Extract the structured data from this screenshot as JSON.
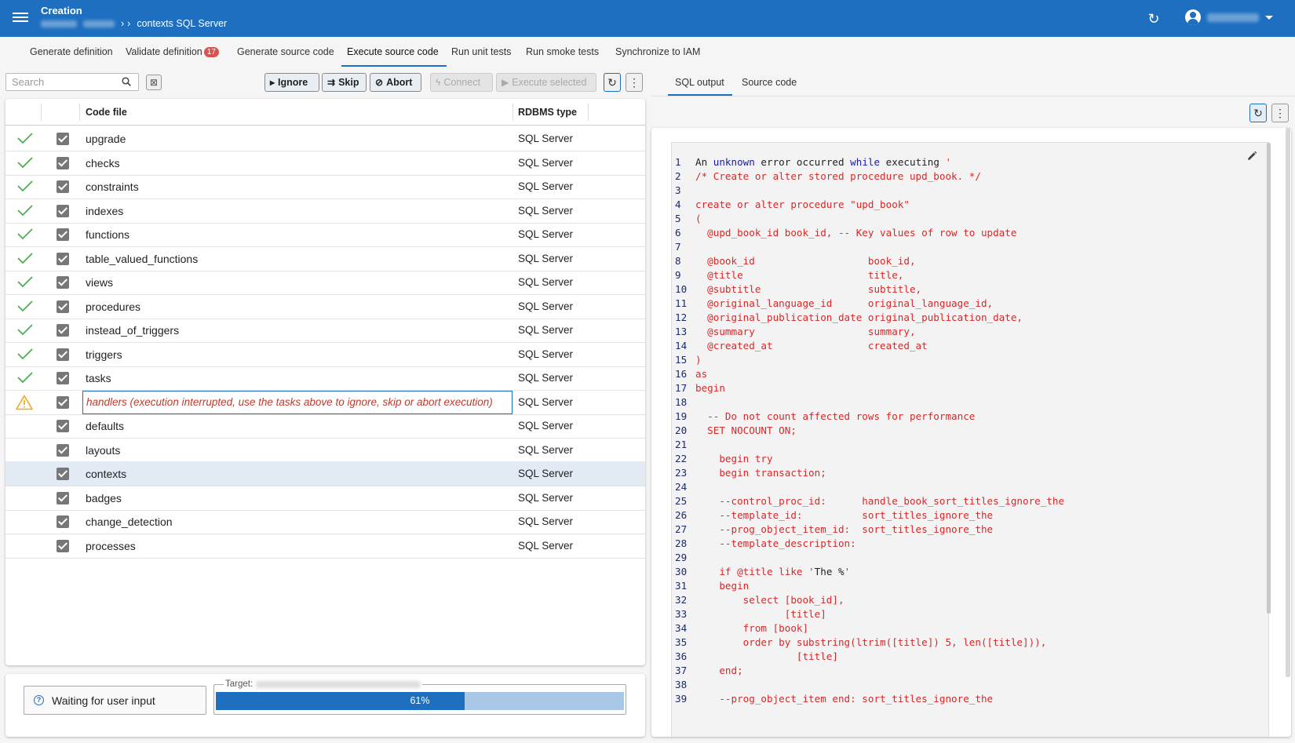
{
  "header": {
    "app_title": "Creation",
    "breadcrumb_current": "contexts SQL Server",
    "colors": {
      "primary": "#1e6fbf",
      "error": "#d42a2a",
      "success": "#4caf50",
      "warning": "#f5a623"
    }
  },
  "tabs": [
    {
      "label": "Generate definition"
    },
    {
      "label": "Validate definition",
      "badge": "17"
    },
    {
      "label": "Generate source code"
    },
    {
      "label": "Execute source code",
      "active": true
    },
    {
      "label": "Run unit tests"
    },
    {
      "label": "Run smoke tests"
    },
    {
      "label": "Synchronize to IAM"
    }
  ],
  "toolbar": {
    "search_placeholder": "Search",
    "ignore_label": "Ignore",
    "skip_label": "Skip",
    "abort_label": "Abort",
    "connect_label": "Connect",
    "execute_selected_label": "Execute selected"
  },
  "table": {
    "columns": {
      "code_file": "Code file",
      "rdbms_type": "RDBMS type"
    },
    "rows": [
      {
        "status": "done",
        "name": "upgrade",
        "type": "SQL Server"
      },
      {
        "status": "done",
        "name": "checks",
        "type": "SQL Server"
      },
      {
        "status": "done",
        "name": "constraints",
        "type": "SQL Server"
      },
      {
        "status": "done",
        "name": "indexes",
        "type": "SQL Server"
      },
      {
        "status": "done",
        "name": "functions",
        "type": "SQL Server"
      },
      {
        "status": "done",
        "name": "table_valued_functions",
        "type": "SQL Server"
      },
      {
        "status": "done",
        "name": "views",
        "type": "SQL Server"
      },
      {
        "status": "done",
        "name": "procedures",
        "type": "SQL Server"
      },
      {
        "status": "done",
        "name": "instead_of_triggers",
        "type": "SQL Server"
      },
      {
        "status": "done",
        "name": "triggers",
        "type": "SQL Server"
      },
      {
        "status": "done",
        "name": "tasks",
        "type": "SQL Server"
      },
      {
        "status": "warning",
        "name": "handlers (execution interrupted, use the tasks above to ignore, skip or abort execution)",
        "type": "SQL Server"
      },
      {
        "status": "pending",
        "name": "defaults",
        "type": "SQL Server"
      },
      {
        "status": "pending",
        "name": "layouts",
        "type": "SQL Server"
      },
      {
        "status": "pending",
        "name": "contexts",
        "type": "SQL Server",
        "selected": true
      },
      {
        "status": "pending",
        "name": "badges",
        "type": "SQL Server"
      },
      {
        "status": "pending",
        "name": "change_detection",
        "type": "SQL Server"
      },
      {
        "status": "pending",
        "name": "processes",
        "type": "SQL Server"
      }
    ]
  },
  "status": {
    "waiting_label": "Waiting for user input",
    "target_label": "Target:",
    "progress_text": "61%",
    "progress_fraction": 0.61
  },
  "right_panel": {
    "tabs": [
      {
        "label": "SQL output",
        "active": true
      },
      {
        "label": "Source code"
      }
    ]
  },
  "code_lines": [
    "An unknown error occurred while executing '",
    "/* Create or alter stored procedure upd_book. */",
    "",
    "create or alter procedure \"upd_book\"",
    "(",
    "  @upd_book_id book_id, -- Key values of row to update",
    "",
    "  @book_id                   book_id,",
    "  @title                     title,",
    "  @subtitle                  subtitle,",
    "  @original_language_id      original_language_id,",
    "  @original_publication_date original_publication_date,",
    "  @summary                   summary,",
    "  @created_at                created_at",
    ")",
    "as",
    "begin",
    "",
    "  -- Do not count affected rows for performance",
    "  SET NOCOUNT ON;",
    "",
    "    begin try",
    "    begin transaction;",
    "",
    "    --control_proc_id:      handle_book_sort_titles_ignore_the",
    "    --template_id:          sort_titles_ignore_the",
    "    --prog_object_item_id:  sort_titles_ignore_the",
    "    --template_description:",
    "",
    "    if @title like 'The %'",
    "    begin",
    "        select [book_id],",
    "               [title]",
    "        from [book]",
    "        order by substring(ltrim([title]) 5, len([title])),",
    "                 [title]",
    "    end;",
    "",
    "    --prog_object_item end: sort_titles_ignore_the"
  ]
}
